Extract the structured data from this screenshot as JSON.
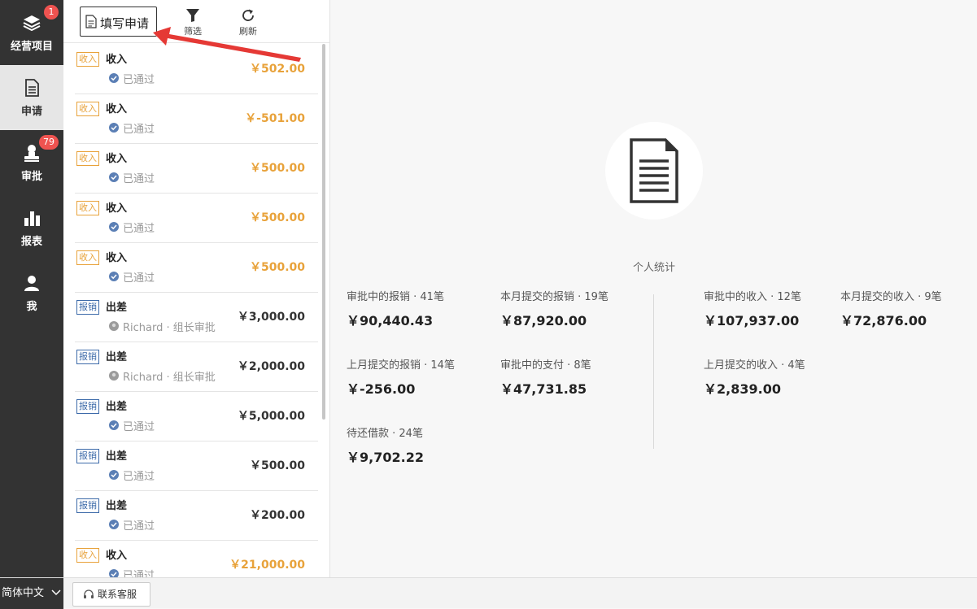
{
  "nav": {
    "items": [
      {
        "label": "经营项目",
        "badge": "1",
        "icon": "layers-icon"
      },
      {
        "label": "申请",
        "badge": "",
        "icon": "document-icon"
      },
      {
        "label": "审批",
        "badge": "79",
        "icon": "stamp-icon"
      },
      {
        "label": "报表",
        "badge": "",
        "icon": "bar-chart-icon"
      },
      {
        "label": "我",
        "badge": "",
        "icon": "user-icon"
      }
    ]
  },
  "toolbar": {
    "apply_label": "填写申请",
    "filter_label": "筛选",
    "refresh_label": "刷新"
  },
  "list": [
    {
      "tag": "收入",
      "type": "income",
      "title": "收入",
      "status": "已通过",
      "status_kind": "approved",
      "amount": "￥502.00"
    },
    {
      "tag": "收入",
      "type": "income",
      "title": "收入",
      "status": "已通过",
      "status_kind": "approved",
      "amount": "￥-501.00"
    },
    {
      "tag": "收入",
      "type": "income",
      "title": "收入",
      "status": "已通过",
      "status_kind": "approved",
      "amount": "￥500.00"
    },
    {
      "tag": "收入",
      "type": "income",
      "title": "收入",
      "status": "已通过",
      "status_kind": "approved",
      "amount": "￥500.00"
    },
    {
      "tag": "收入",
      "type": "income",
      "title": "收入",
      "status": "已通过",
      "status_kind": "approved",
      "amount": "￥500.00"
    },
    {
      "tag": "报销",
      "type": "reimb",
      "title": "出差",
      "status": "Richard · 组长审批",
      "status_kind": "pending",
      "amount": "￥3,000.00"
    },
    {
      "tag": "报销",
      "type": "reimb",
      "title": "出差",
      "status": "Richard · 组长审批",
      "status_kind": "pending",
      "amount": "￥2,000.00"
    },
    {
      "tag": "报销",
      "type": "reimb",
      "title": "出差",
      "status": "已通过",
      "status_kind": "approved",
      "amount": "￥5,000.00"
    },
    {
      "tag": "报销",
      "type": "reimb",
      "title": "出差",
      "status": "已通过",
      "status_kind": "approved",
      "amount": "￥500.00"
    },
    {
      "tag": "报销",
      "type": "reimb",
      "title": "出差",
      "status": "已通过",
      "status_kind": "approved",
      "amount": "￥200.00"
    },
    {
      "tag": "收入",
      "type": "income",
      "title": "收入",
      "status": "已通过",
      "status_kind": "approved",
      "amount": "￥21,000.00"
    }
  ],
  "bottom": {
    "language": "简体中文",
    "support_label": "联系客服"
  },
  "stats": {
    "title": "个人统计",
    "items": [
      {
        "label": "审批中的报销 · 41笔",
        "value": "￥90,440.43"
      },
      {
        "label": "本月提交的报销 · 19笔",
        "value": "￥87,920.00"
      },
      {
        "label": "上月提交的报销 · 14笔",
        "value": "￥-256.00"
      },
      {
        "label": "审批中的支付 · 8笔",
        "value": "￥47,731.85"
      },
      {
        "label": "待还借款 · 24笔",
        "value": "￥9,702.22"
      },
      {
        "label": "审批中的收入 · 12笔",
        "value": "￥107,937.00"
      },
      {
        "label": "本月提交的收入 · 9笔",
        "value": "￥72,876.00"
      },
      {
        "label": "上月提交的收入 · 4笔",
        "value": "￥2,839.00"
      }
    ]
  },
  "colors": {
    "nav_bg": "#333333",
    "income": "#e8a23a",
    "reimb": "#3c6aa9",
    "badge": "#ef5350",
    "arrow": "#e53935"
  }
}
